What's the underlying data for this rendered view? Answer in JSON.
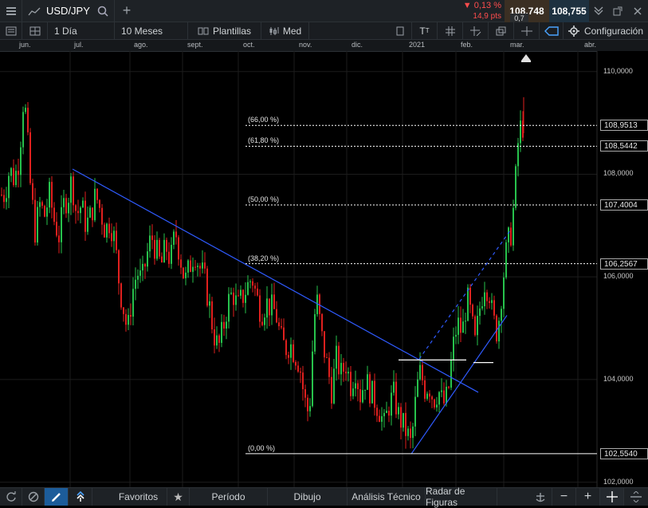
{
  "header": {
    "symbol": "USD/JPY",
    "change_pct": "▼ 0,13 %",
    "change_pts": "14,9 pts",
    "bid": "108,748",
    "ask": "108,755",
    "spread": "0,7"
  },
  "toolbar": {
    "interval": "1 Día",
    "range": "10 Meses",
    "templates": "Plantillas",
    "style": "Med",
    "settings": "Configuración"
  },
  "time_axis": {
    "labels": [
      "jun.",
      "jul.",
      "ago.",
      "sept.",
      "oct.",
      "nov.",
      "dic.",
      "2021",
      "feb.",
      "mar.",
      "abr."
    ]
  },
  "bottom_bar": {
    "favorites": "Favoritos",
    "period": "Período",
    "drawing": "Dibujo",
    "technical": "Análisis Técnico",
    "patterns": "Radar de Figuras"
  },
  "chart_data": {
    "type": "candlestick",
    "ylim": [
      101.9,
      110.4
    ],
    "y_ticks": [
      "110,0000",
      "108,0000",
      "106,0000",
      "104,0000",
      "102,0000"
    ],
    "y_tick_values": [
      110,
      108,
      106,
      104,
      102
    ],
    "fib_levels": [
      {
        "label": "(66,00 %)",
        "value": 108.9513,
        "value_label": "108,9513"
      },
      {
        "label": "(61,80 %)",
        "value": 108.5442,
        "value_label": "108,5442"
      },
      {
        "label": "(50,00 %)",
        "value": 107.4004,
        "value_label": "107,4004"
      },
      {
        "label": "(38,20 %)",
        "value": 106.2567,
        "value_label": "106,2567"
      },
      {
        "label": "(0,00 %)",
        "value": 102.554,
        "value_label": "102,5540"
      }
    ],
    "close_path": [
      [
        0,
        107.6
      ],
      [
        6,
        107.6
      ],
      [
        12,
        108.1
      ],
      [
        18,
        107.9
      ],
      [
        24,
        108.3
      ],
      [
        30,
        109.6
      ],
      [
        34,
        108.8
      ],
      [
        38,
        107.8
      ],
      [
        44,
        106.9
      ],
      [
        50,
        107.4
      ],
      [
        56,
        107.2
      ],
      [
        62,
        107.6
      ],
      [
        68,
        107.1
      ],
      [
        74,
        106.8
      ],
      [
        80,
        107.4
      ],
      [
        86,
        107.6
      ],
      [
        90,
        107.9
      ],
      [
        96,
        107.2
      ],
      [
        102,
        107.4
      ],
      [
        108,
        107.0
      ],
      [
        114,
        107.2
      ],
      [
        120,
        107.6
      ],
      [
        126,
        107.3
      ],
      [
        132,
        106.9
      ],
      [
        138,
        107.1
      ],
      [
        144,
        106.7
      ],
      [
        150,
        105.8
      ],
      [
        156,
        105.3
      ],
      [
        160,
        104.9
      ],
      [
        166,
        105.7
      ],
      [
        172,
        106.1
      ],
      [
        178,
        105.9
      ],
      [
        184,
        106.4
      ],
      [
        190,
        106.8
      ],
      [
        196,
        106.5
      ],
      [
        202,
        106.2
      ],
      [
        208,
        106.6
      ],
      [
        214,
        106.3
      ],
      [
        220,
        106.9
      ],
      [
        226,
        106.4
      ],
      [
        232,
        105.9
      ],
      [
        238,
        106.2
      ],
      [
        244,
        106.5
      ],
      [
        250,
        106.2
      ],
      [
        256,
        106.0
      ],
      [
        262,
        105.5
      ],
      [
        268,
        104.9
      ],
      [
        274,
        104.6
      ],
      [
        280,
        105.0
      ],
      [
        286,
        105.5
      ],
      [
        292,
        105.7
      ],
      [
        298,
        105.4
      ],
      [
        304,
        105.6
      ],
      [
        310,
        105.8
      ],
      [
        316,
        106.0
      ],
      [
        322,
        105.6
      ],
      [
        328,
        105.3
      ],
      [
        334,
        105.5
      ],
      [
        340,
        105.4
      ],
      [
        346,
        105.3
      ],
      [
        352,
        104.8
      ],
      [
        358,
        104.6
      ],
      [
        364,
        104.7
      ],
      [
        370,
        104.5
      ],
      [
        376,
        104.3
      ],
      [
        382,
        103.6
      ],
      [
        388,
        103.3
      ],
      [
        394,
        105.2
      ],
      [
        398,
        105.5
      ],
      [
        404,
        104.8
      ],
      [
        410,
        104.3
      ],
      [
        416,
        103.8
      ],
      [
        422,
        104.4
      ],
      [
        428,
        104.1
      ],
      [
        434,
        104.3
      ],
      [
        440,
        103.9
      ],
      [
        446,
        104.2
      ],
      [
        452,
        103.7
      ],
      [
        458,
        104.0
      ],
      [
        464,
        103.8
      ],
      [
        470,
        103.6
      ],
      [
        476,
        103.4
      ],
      [
        482,
        103.1
      ],
      [
        488,
        103.5
      ],
      [
        494,
        103.7
      ],
      [
        500,
        103.3
      ],
      [
        506,
        103.1
      ],
      [
        512,
        102.9
      ],
      [
        516,
        102.7
      ],
      [
        520,
        103.4
      ],
      [
        524,
        103.9
      ],
      [
        528,
        104.2
      ],
      [
        532,
        103.8
      ],
      [
        538,
        103.9
      ],
      [
        544,
        103.6
      ],
      [
        550,
        103.8
      ],
      [
        556,
        103.5
      ],
      [
        562,
        103.7
      ],
      [
        566,
        104.3
      ],
      [
        570,
        104.8
      ],
      [
        574,
        105.1
      ],
      [
        580,
        104.9
      ],
      [
        586,
        105.6
      ],
      [
        590,
        105.3
      ],
      [
        596,
        104.7
      ],
      [
        602,
        105.4
      ],
      [
        608,
        105.9
      ],
      [
        614,
        105.7
      ],
      [
        618,
        105.2
      ],
      [
        624,
        104.9
      ],
      [
        630,
        105.8
      ],
      [
        636,
        106.6
      ],
      [
        642,
        106.9
      ],
      [
        646,
        107.7
      ],
      [
        650,
        108.6
      ],
      [
        654,
        109.0
      ],
      [
        657,
        108.9
      ]
    ],
    "trendlines": [
      {
        "x1": 91,
        "y1": 108.1,
        "x2": 600,
        "y2": 103.75,
        "style": "solid"
      },
      {
        "x1": 516,
        "y1": 102.55,
        "x2": 636,
        "y2": 105.25,
        "style": "solid"
      },
      {
        "x1": 526,
        "y1": 104.4,
        "x2": 640,
        "y2": 106.9,
        "style": "dashed"
      }
    ],
    "h_segments": [
      {
        "x1": 500,
        "x2": 585,
        "y": 104.38
      },
      {
        "x1": 594,
        "x2": 619,
        "y": 104.33
      }
    ]
  }
}
